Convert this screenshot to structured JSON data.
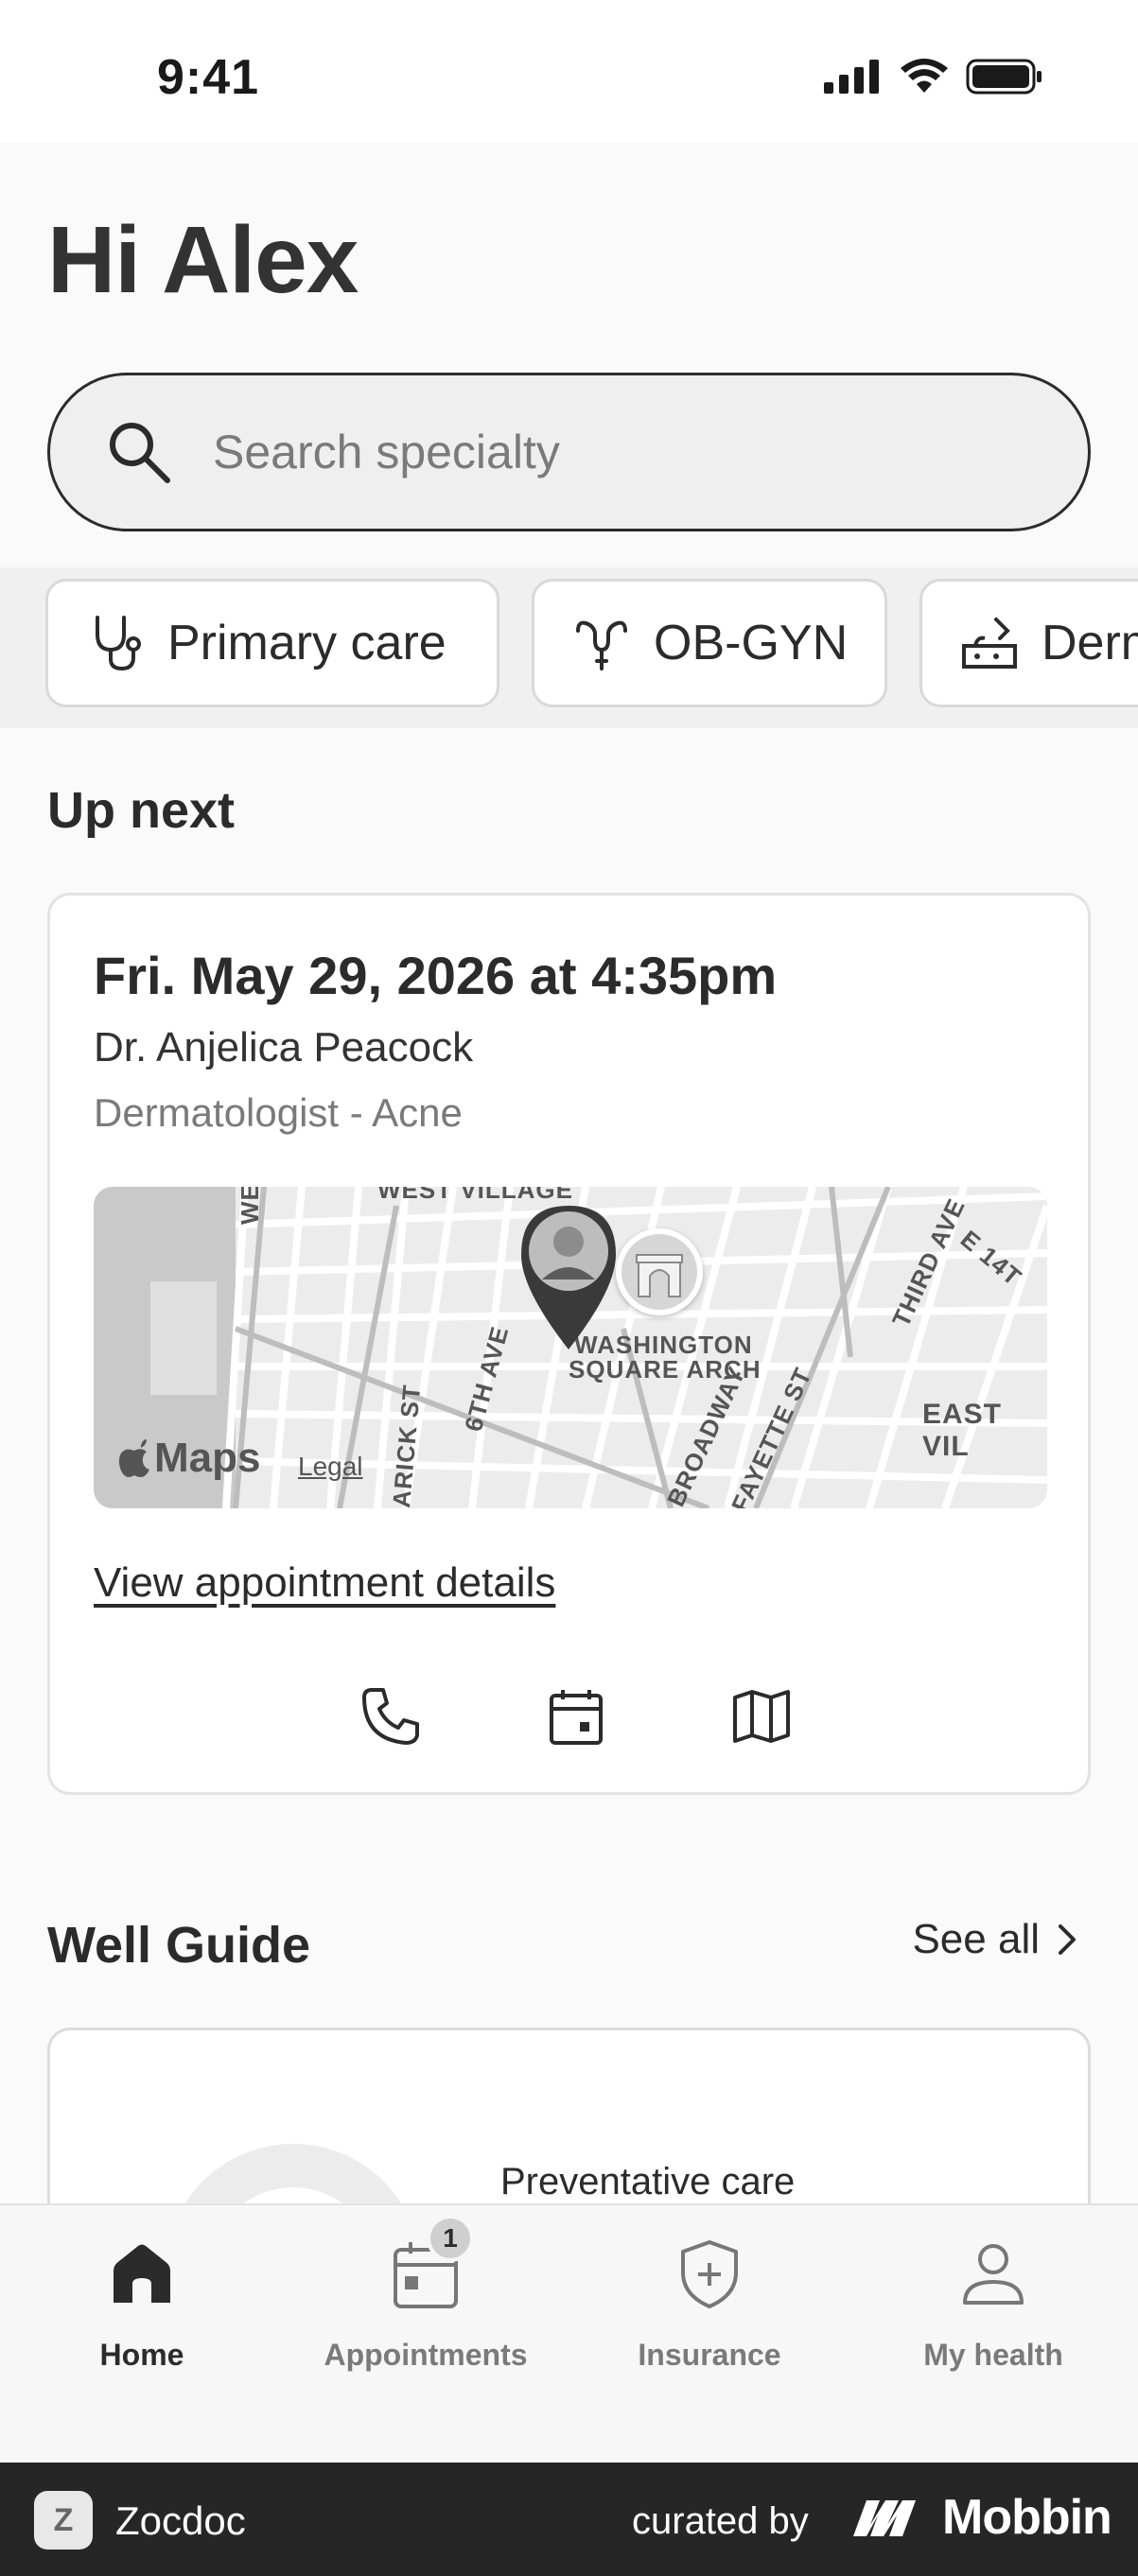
{
  "status": {
    "time": "9:41"
  },
  "greeting": "Hi Alex",
  "search": {
    "placeholder": "Search specialty"
  },
  "specialties": [
    {
      "label": "Primary care",
      "icon": "stethoscope-icon"
    },
    {
      "label": "OB-GYN",
      "icon": "uterus-icon"
    },
    {
      "label": "Derm",
      "icon": "dermatology-icon"
    }
  ],
  "up_next": {
    "title": "Up next",
    "date_time": "Fri. May 29, 2026 at 4:35pm",
    "doctor": "Dr. Anjelica Peacock",
    "specialty": "Dermatologist - Acne",
    "map": {
      "logo": "Maps",
      "legal": "Legal",
      "labels": {
        "west_village": "WEST VILLAGE",
        "west": "WEST",
        "landmark": "WASHINGTON",
        "landmark2": "SQUARE ARCH",
        "sixth_ave": "6TH AVE",
        "varick": "ARICK ST",
        "broadway": "BROADWAY",
        "lafayette": "FAYETTE ST",
        "third_ave": "THIRD AVE",
        "e14": "E 14T",
        "east_village": "EAST VIL"
      }
    },
    "details_link": "View appointment details",
    "actions": [
      "phone-icon",
      "calendar-icon",
      "map-icon"
    ]
  },
  "well_guide": {
    "title": "Well Guide",
    "see_all": "See all",
    "card_title": "Preventative care"
  },
  "tabs": [
    {
      "label": "Home",
      "icon": "home-icon",
      "active": true
    },
    {
      "label": "Appointments",
      "icon": "appointments-icon",
      "badge": "1"
    },
    {
      "label": "Insurance",
      "icon": "insurance-shield-icon"
    },
    {
      "label": "My health",
      "icon": "person-icon"
    }
  ],
  "footer": {
    "app_name": "Zocdoc",
    "logo_letter": "Z",
    "curated_by": "curated by",
    "brand": "Mobbin"
  }
}
